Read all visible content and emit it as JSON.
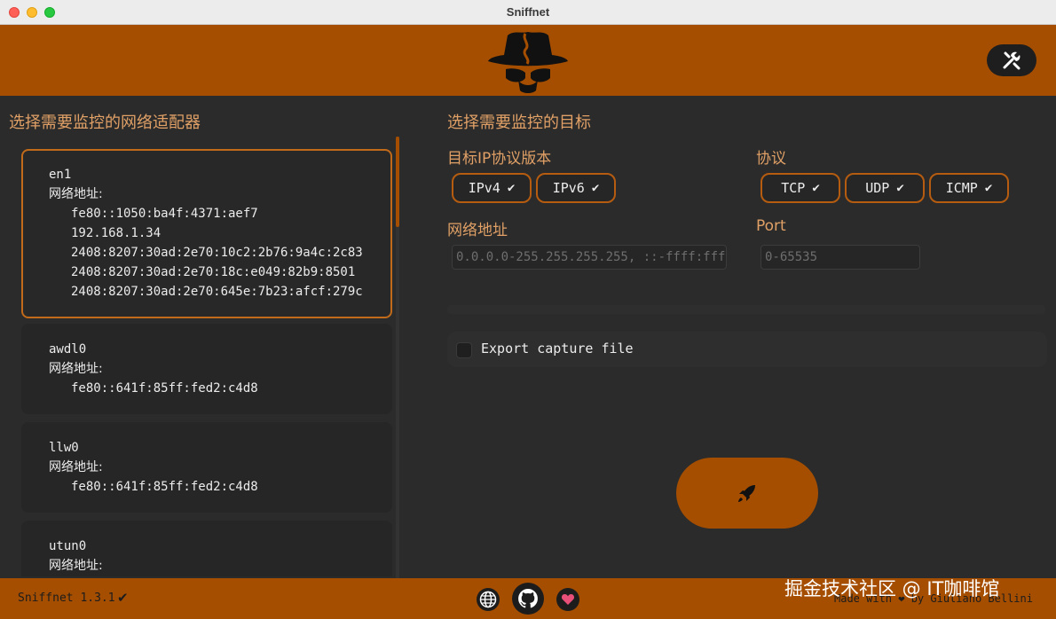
{
  "window": {
    "title": "Sniffnet"
  },
  "left": {
    "title": "选择需要监控的网络适配器",
    "address_label": "网络地址:",
    "adapters": [
      {
        "name": "en1",
        "addresses": [
          "fe80::1050:ba4f:4371:aef7",
          "192.168.1.34",
          "2408:8207:30ad:2e70:10c2:2b76:9a4c:2c83",
          "2408:8207:30ad:2e70:18c:e049:82b9:8501",
          "2408:8207:30ad:2e70:645e:7b23:afcf:279c"
        ],
        "selected": true
      },
      {
        "name": "awdl0",
        "addresses": [
          "fe80::641f:85ff:fed2:c4d8"
        ],
        "selected": false
      },
      {
        "name": "llw0",
        "addresses": [
          "fe80::641f:85ff:fed2:c4d8"
        ],
        "selected": false
      },
      {
        "name": "utun0",
        "addresses": [],
        "selected": false
      }
    ]
  },
  "right": {
    "title": "选择需要监控的目标",
    "ip_version": {
      "label": "目标IP协议版本",
      "options": [
        "IPv4",
        "IPv6"
      ]
    },
    "protocol": {
      "label": "协议",
      "options": [
        "TCP",
        "UDP",
        "ICMP"
      ]
    },
    "address": {
      "label": "网络地址",
      "placeholder": "0.0.0.0-255.255.255.255, ::-ffff:fff"
    },
    "port": {
      "label": "Port",
      "placeholder": "0-65535"
    },
    "export": {
      "label": "Export capture file",
      "checked": false
    }
  },
  "footer": {
    "version": "Sniffnet 1.3.1",
    "made_with": "Made with ❤ by Giuliano Bellini",
    "watermark": "掘金技术社区 @ IT咖啡馆"
  },
  "icons": {
    "check": "✔"
  },
  "colors": {
    "accent": "#a54e00",
    "background": "#2b2b2b",
    "title_text": "#e0a066"
  }
}
